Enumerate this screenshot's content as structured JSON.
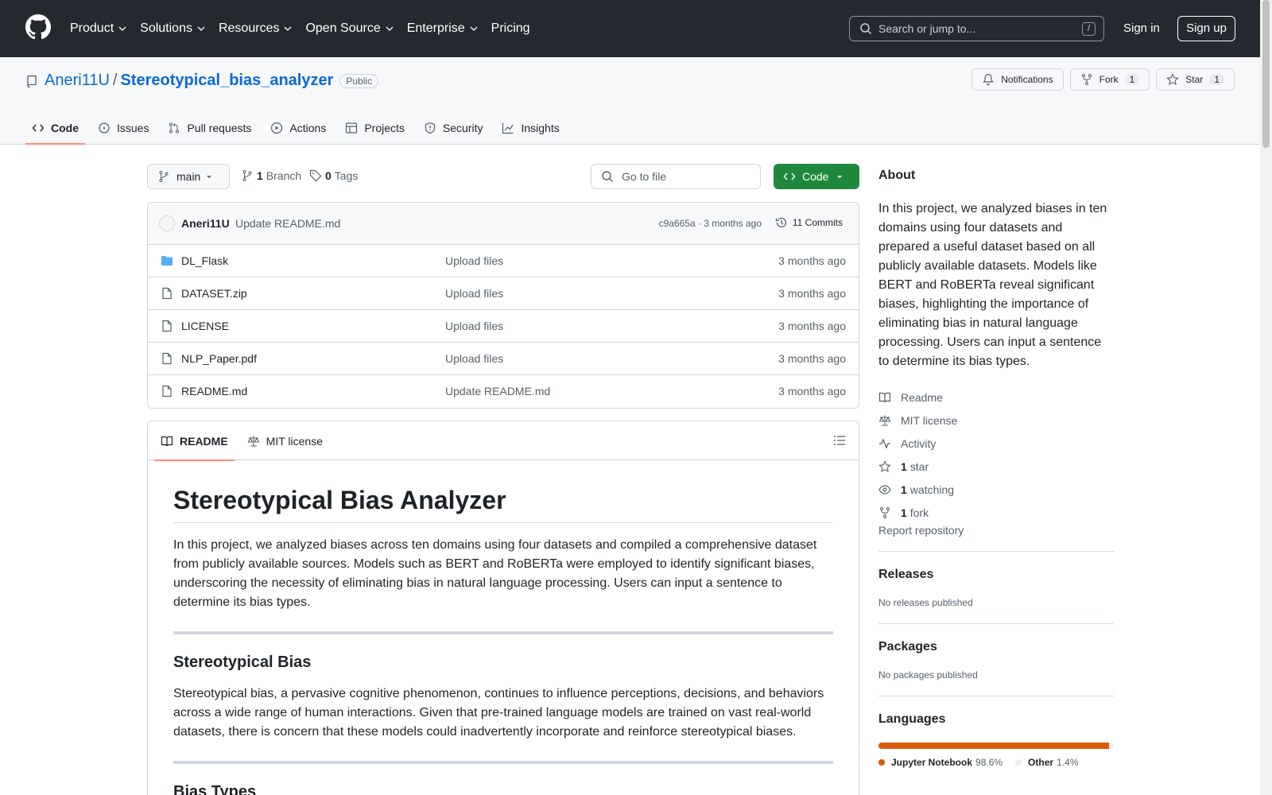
{
  "header": {
    "nav": [
      "Product",
      "Solutions",
      "Resources",
      "Open Source",
      "Enterprise",
      "Pricing"
    ],
    "search_placeholder": "Search or jump to...",
    "search_shortcut": "/",
    "signin": "Sign in",
    "signup": "Sign up"
  },
  "repo": {
    "owner": "Aneri11U",
    "separator": "/",
    "name": "Stereotypical_bias_analyzer",
    "visibility": "Public",
    "notifications": "Notifications",
    "fork_label": "Fork",
    "fork_count": "1",
    "star_label": "Star",
    "star_count": "1"
  },
  "tabs": [
    "Code",
    "Issues",
    "Pull requests",
    "Actions",
    "Projects",
    "Security",
    "Insights"
  ],
  "toolbar": {
    "branch": "main",
    "branches_count": "1",
    "branches_label": "Branch",
    "tags_count": "0",
    "tags_label": "Tags",
    "goto_placeholder": "Go to file",
    "code_label": "Code"
  },
  "latest_commit": {
    "author": "Aneri11U",
    "message": "Update README.md",
    "hash_time": "c9a665a · 3 months ago",
    "commits": "11 Commits"
  },
  "files": [
    {
      "name": "DL_Flask",
      "type": "folder",
      "message": "Upload files",
      "time": "3 months ago"
    },
    {
      "name": "DATASET.zip",
      "type": "file",
      "message": "Upload files",
      "time": "3 months ago"
    },
    {
      "name": "LICENSE",
      "type": "file",
      "message": "Upload files",
      "time": "3 months ago"
    },
    {
      "name": "NLP_Paper.pdf",
      "type": "file",
      "message": "Upload files",
      "time": "3 months ago"
    },
    {
      "name": "README.md",
      "type": "file",
      "message": "Update README.md",
      "time": "3 months ago"
    }
  ],
  "readme": {
    "tab_readme": "README",
    "tab_license": "MIT license",
    "title": "Stereotypical Bias Analyzer",
    "intro": "In this project, we analyzed biases across ten domains using four datasets and compiled a comprehensive dataset from publicly available sources. Models such as BERT and RoBERTa were employed to identify significant biases, underscoring the necessity of eliminating bias in natural language processing. Users can input a sentence to determine its bias types.",
    "h2_1": "Stereotypical Bias",
    "p_1": "Stereotypical bias, a pervasive cognitive phenomenon, continues to influence perceptions, decisions, and behaviors across a wide range of human interactions. Given that pre-trained language models are trained on vast real-world datasets, there is concern that these models could inadvertently incorporate and reinforce stereotypical biases.",
    "h2_2": "Bias Types"
  },
  "about": {
    "title": "About",
    "description": "In this project, we analyzed biases in ten domains using four datasets and prepared a useful dataset based on all publicly available datasets. Models like BERT and RoBERTa reveal significant biases, highlighting the importance of eliminating bias in natural language processing. Users can input a sentence to determine its bias types.",
    "readme": "Readme",
    "license": "MIT license",
    "activity": "Activity",
    "stars_count": "1",
    "stars_label": "star",
    "watching_count": "1",
    "watching_label": "watching",
    "forks_count": "1",
    "forks_label": "fork",
    "report": "Report repository"
  },
  "releases": {
    "title": "Releases",
    "text": "No releases published"
  },
  "packages": {
    "title": "Packages",
    "text": "No packages published"
  },
  "languages": {
    "title": "Languages",
    "items": [
      {
        "name": "Jupyter Notebook",
        "percent": "98.6%",
        "value": 98.6,
        "color": "#DA5B0B"
      },
      {
        "name": "Other",
        "percent": "1.4%",
        "value": 1.4,
        "color": "#ededed"
      }
    ]
  }
}
